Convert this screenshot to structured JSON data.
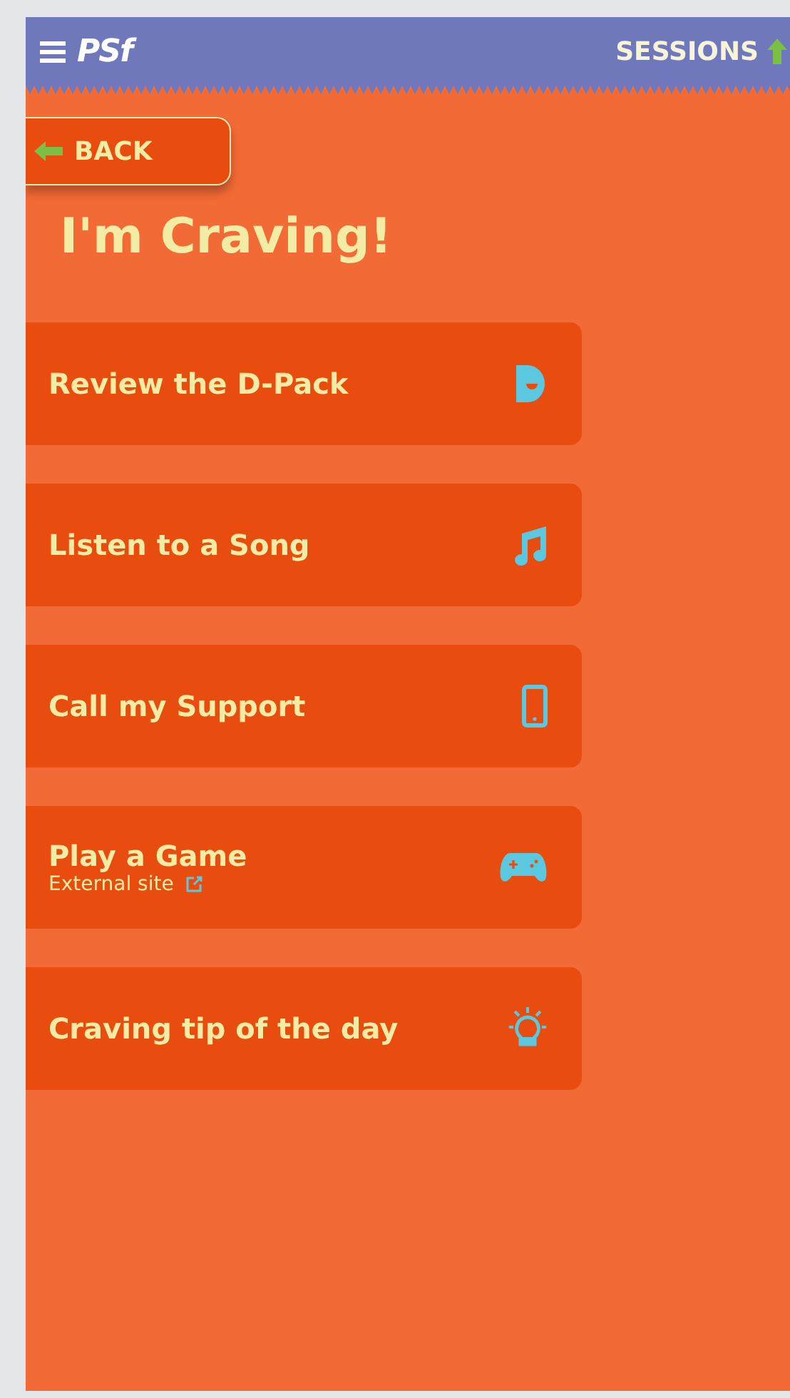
{
  "header": {
    "logo": "PSf",
    "sessions_label": "SESSIONS"
  },
  "back_button": {
    "label": "BACK"
  },
  "title": "I'm Craving!",
  "menu": [
    {
      "label": "Review the D-Pack"
    },
    {
      "label": "Listen to a Song"
    },
    {
      "label": "Call my Support"
    },
    {
      "label": "Play a Game",
      "note": "External site"
    },
    {
      "label": "Craving tip of the day"
    }
  ]
}
